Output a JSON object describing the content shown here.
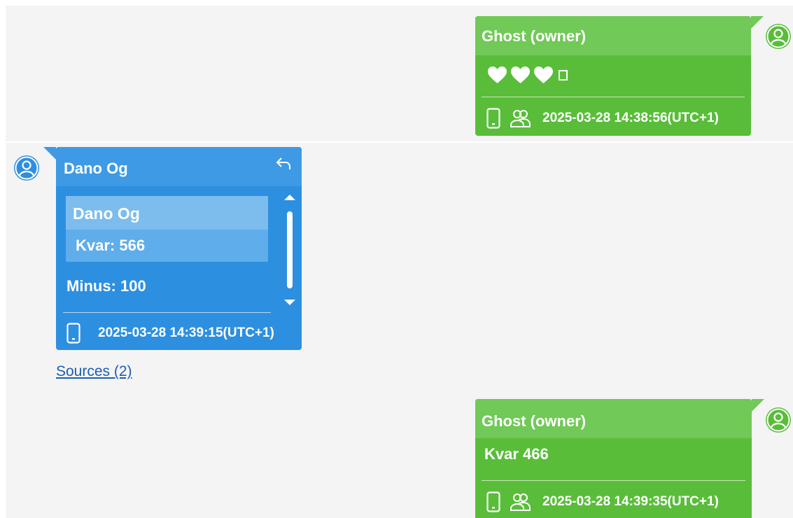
{
  "colors": {
    "owner_bubble": "#59bd3a",
    "owner_header": "#71c957",
    "contact_bubble": "#2d8fe0",
    "contact_header": "#3e9ae4",
    "link": "#1a5fb4",
    "background": "#f4f4f4"
  },
  "messages": [
    {
      "sender": "Ghost (owner)",
      "direction": "outgoing",
      "content_icons": [
        "white-heart-icon",
        "white-heart-icon",
        "white-heart-icon",
        "missing-glyph-icon"
      ],
      "device_icon": "phone-icon",
      "participants_icon": "people-icon",
      "timestamp": "2025-03-28 14:38:56(UTC+1)"
    },
    {
      "sender": "Dano Og",
      "direction": "incoming",
      "reply_icon": "reply-arrow-icon",
      "quoted": {
        "sender": "Dano Og",
        "text": "Kvar: 566"
      },
      "text": "Minus: 100",
      "device_icon": "phone-icon",
      "timestamp": "2025-03-28 14:39:15(UTC+1)",
      "sources_link": "Sources (2)"
    },
    {
      "sender": "Ghost (owner)",
      "direction": "outgoing",
      "text": "Kvar 466",
      "device_icon": "phone-icon",
      "participants_icon": "people-icon",
      "timestamp": "2025-03-28 14:39:35(UTC+1)"
    }
  ]
}
